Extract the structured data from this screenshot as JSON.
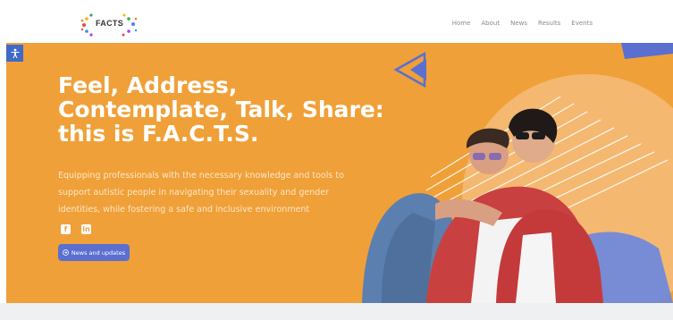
{
  "logo": {
    "text": "FACTS"
  },
  "nav": [
    {
      "label": "Home"
    },
    {
      "label": "About"
    },
    {
      "label": "News"
    },
    {
      "label": "Results"
    },
    {
      "label": "Events"
    }
  ],
  "accessibility": {
    "icon": "accessibility-icon"
  },
  "hero": {
    "title": "Feel, Address, Contemplate, Talk, Share: this is F.A.C.T.S.",
    "subtitle": "Equipping professionals with the necessary knowledge and tools to support autistic people in navigating their sexuality and gender identities, while fostering a safe and inclusive environment",
    "socials": [
      {
        "icon": "facebook-icon",
        "glyph": "f"
      },
      {
        "icon": "linkedin-icon",
        "glyph": "in"
      }
    ],
    "cta_label": "News and updates",
    "cta_icon": "arrow-circle-icon"
  },
  "colors": {
    "hero_bg": "#f0a038",
    "accent_blue": "#5a6fd0",
    "text_white": "#ffffff",
    "footer_strip": "#eef0f1"
  }
}
